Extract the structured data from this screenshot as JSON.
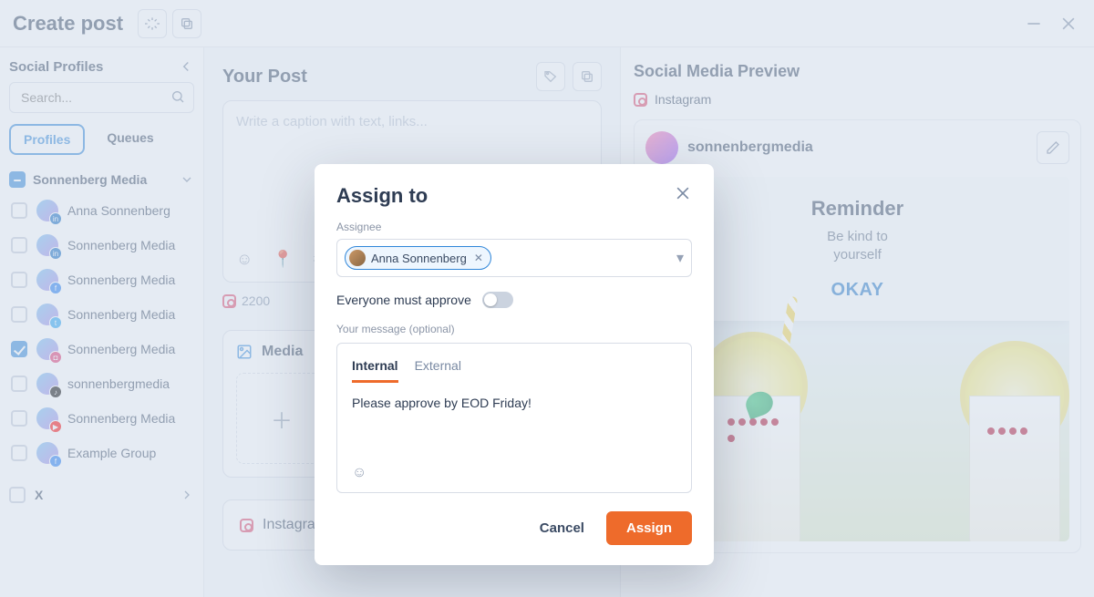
{
  "header": {
    "title": "Create post"
  },
  "sidebar": {
    "title": "Social Profiles",
    "search_placeholder": "Search...",
    "tabs": {
      "profiles": "Profiles",
      "queues": "Queues"
    },
    "group": {
      "name": "Sonnenberg Media",
      "items": [
        {
          "label": "Anna Sonnenberg",
          "checked": false,
          "net": "li"
        },
        {
          "label": "Sonnenberg Media",
          "checked": false,
          "net": "lip"
        },
        {
          "label": "Sonnenberg Media",
          "checked": false,
          "net": "fb"
        },
        {
          "label": "Sonnenberg Media",
          "checked": false,
          "net": "tw"
        },
        {
          "label": "Sonnenberg Media",
          "checked": true,
          "net": "ig"
        },
        {
          "label": "sonnenbergmedia",
          "checked": false,
          "net": "tt"
        },
        {
          "label": "Sonnenberg Media",
          "checked": false,
          "net": "yt"
        },
        {
          "label": "Example Group",
          "checked": false,
          "net": "fbg"
        }
      ]
    },
    "closed_group": "X"
  },
  "post": {
    "title": "Your Post",
    "caption_placeholder": "Write a caption with text, links...",
    "counter": "2200",
    "media_label": "Media",
    "network_card_label": "Instagram"
  },
  "preview": {
    "title": "Social Media Preview",
    "network_label": "Instagram",
    "handle": "sonnenbergmedia",
    "banner": {
      "title": "Reminder",
      "line1": "Be kind to",
      "line2": "yourself",
      "ok": "OKAY"
    }
  },
  "modal": {
    "title": "Assign to",
    "assignee_label": "Assignee",
    "chip_name": "Anna Sonnenberg",
    "approve_label": "Everyone must approve",
    "message_label": "Your message (optional)",
    "tabs": {
      "internal": "Internal",
      "external": "External"
    },
    "message_text": "Please approve by EOD Friday!",
    "cancel": "Cancel",
    "assign": "Assign"
  }
}
